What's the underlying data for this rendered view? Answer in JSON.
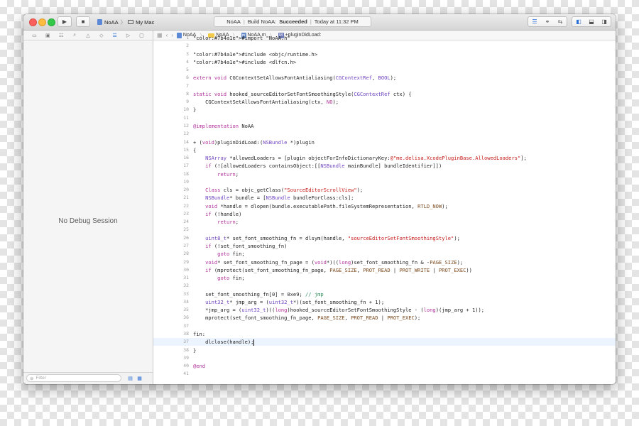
{
  "toolbar": {
    "scheme_project": "NoAA",
    "scheme_separator": "〉",
    "scheme_destination": "My Mac",
    "activity_project": "NoAA",
    "activity_build_prefix": "Build NoAA:",
    "activity_build_status": "Succeeded",
    "activity_time": "Today at 11:32 PM"
  },
  "navigator": {
    "empty_message": "No Debug Session",
    "filter_placeholder": "Filter"
  },
  "jumpbar": {
    "items": [
      "NoAA",
      "NoAA",
      "NoAA.m",
      "+pluginDidLoad:"
    ]
  },
  "editor": {
    "current_line": "37",
    "lines": [
      {
        "n": "1",
        "t": "#import \"NoAA.h\""
      },
      {
        "n": "2",
        "t": ""
      },
      {
        "n": "3",
        "t": "#include <objc/runtime.h>"
      },
      {
        "n": "4",
        "t": "#include <dlfcn.h>"
      },
      {
        "n": "5",
        "t": ""
      },
      {
        "n": "6",
        "t": "extern void CGContextSetAllowsFontAntialiasing(CGContextRef, BOOL);"
      },
      {
        "n": "7",
        "t": ""
      },
      {
        "n": "8",
        "t": "static void hooked_sourceEditorSetFontSmoothingStyle(CGContextRef ctx) {"
      },
      {
        "n": "9",
        "t": "    CGContextSetAllowsFontAntialiasing(ctx, NO);"
      },
      {
        "n": "10",
        "t": "}"
      },
      {
        "n": "11",
        "t": ""
      },
      {
        "n": "12",
        "t": "@implementation NoAA"
      },
      {
        "n": "13",
        "t": ""
      },
      {
        "n": "14",
        "t": "+ (void)pluginDidLoad:(NSBundle *)plugin"
      },
      {
        "n": "15",
        "t": "{"
      },
      {
        "n": "16",
        "t": "    NSArray *allowedLoaders = [plugin objectForInfoDictionaryKey:@\"me.delisa.XcodePluginBase.AllowedLoaders\"];"
      },
      {
        "n": "17",
        "t": "    if (![allowedLoaders containsObject:[[NSBundle mainBundle] bundleIdentifier]])"
      },
      {
        "n": "18",
        "t": "        return;"
      },
      {
        "n": "19",
        "t": ""
      },
      {
        "n": "20",
        "t": "    Class cls = objc_getClass(\"SourceEditorScrollView\");"
      },
      {
        "n": "21",
        "t": "    NSBundle* bundle = [NSBundle bundleForClass:cls];"
      },
      {
        "n": "22",
        "t": "    void *handle = dlopen(bundle.executablePath.fileSystemRepresentation, RTLD_NOW);"
      },
      {
        "n": "23",
        "t": "    if (!handle)"
      },
      {
        "n": "24",
        "t": "        return;"
      },
      {
        "n": "25",
        "t": ""
      },
      {
        "n": "26",
        "t": "    uint8_t* set_font_smoothing_fn = dlsym(handle, \"sourceEditorSetFontSmoothingStyle\");"
      },
      {
        "n": "27",
        "t": "    if (!set_font_smoothing_fn)"
      },
      {
        "n": "28",
        "t": "        goto fin;"
      },
      {
        "n": "29",
        "t": "    void* set_font_smoothing_fn_page = (void*)((long)set_font_smoothing_fn & -PAGE_SIZE);"
      },
      {
        "n": "30",
        "t": "    if (mprotect(set_font_smoothing_fn_page, PAGE_SIZE, PROT_READ | PROT_WRITE | PROT_EXEC))"
      },
      {
        "n": "31",
        "t": "        goto fin;"
      },
      {
        "n": "32",
        "t": ""
      },
      {
        "n": "33",
        "t": "    set_font_smoothing_fn[0] = 0xe9; // jmp"
      },
      {
        "n": "34",
        "t": "    uint32_t* jmp_arg = (uint32_t*)(set_font_smoothing_fn + 1);"
      },
      {
        "n": "35",
        "t": "    *jmp_arg = (uint32_t)((long)hooked_sourceEditorSetFontSmoothingStyle - (long)(jmp_arg + 1));"
      },
      {
        "n": "36",
        "t": "    mprotect(set_font_smoothing_fn_page, PAGE_SIZE, PROT_READ | PROT_EXEC);"
      },
      {
        "n": "37",
        "t": ""
      },
      {
        "n": "38",
        "t": "fin:"
      },
      {
        "n": "37",
        "t": "    dlclose(handle);"
      },
      {
        "n": "38",
        "t": "}"
      },
      {
        "n": "39",
        "t": ""
      },
      {
        "n": "40",
        "t": "@end"
      },
      {
        "n": "41",
        "t": ""
      }
    ]
  },
  "colors": {
    "keyword": "#b0309a",
    "string": "#c41a16",
    "type": "#6f42c1",
    "macro": "#7b4a1e",
    "comment": "#2e8b57",
    "number": "#2f3fd1"
  }
}
